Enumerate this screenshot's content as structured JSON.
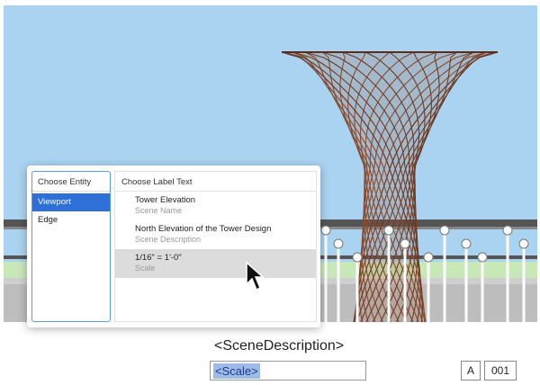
{
  "popup": {
    "entity_header": "Choose Entity",
    "entities": [
      "Viewport",
      "Edge"
    ],
    "label_header": "Choose Label Text",
    "options": [
      {
        "value": "Tower Elevation",
        "key": "Scene Name"
      },
      {
        "value": "North Elevation of the Tower Design",
        "key": "Scene Description"
      },
      {
        "value": "1/16\" = 1'-0\"",
        "key": "Scale"
      }
    ]
  },
  "title_block": {
    "scene_description": "<SceneDescription>",
    "scale": "<Scale>",
    "sheet_letter": "A",
    "sheet_number": "001"
  },
  "colors": {
    "sky": "#a9d3f0",
    "tower": "#8a4a2e",
    "selection": "#2f6fd8"
  }
}
